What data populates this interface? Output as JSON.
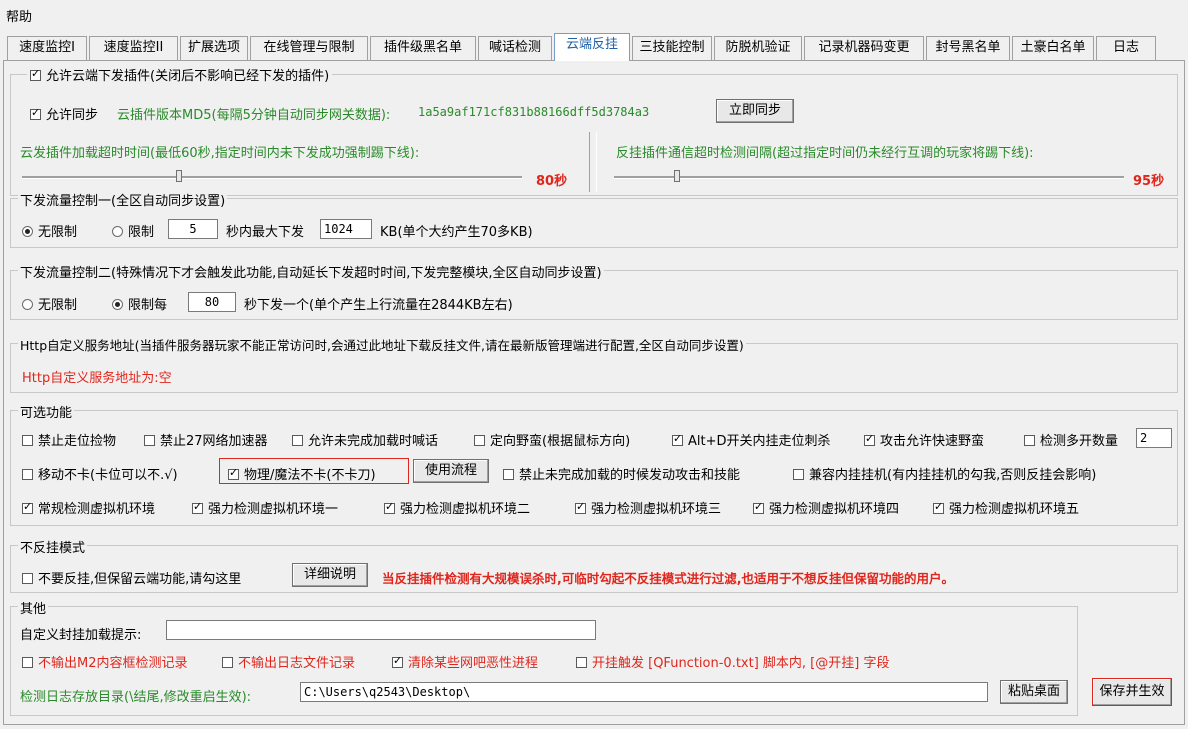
{
  "menu": {
    "help": "帮助"
  },
  "tabs": [
    "速度监控I",
    "速度监控II",
    "扩展选项",
    "在线管理与限制",
    "插件级黑名单",
    "喊话检测",
    "云端反挂",
    "三技能控制",
    "防脱机验证",
    "记录机器码变更",
    "封号黑名单",
    "土豪白名单",
    "日志"
  ],
  "active_tab": "云端反挂",
  "cloud": {
    "allow_cloud_label": "允许云端下发插件(关闭后不影响已经下发的插件)",
    "allow_sync_label": "允许同步",
    "md5_label": "云插件版本MD5(每隔5分钟自动同步网关数据):",
    "md5_value": "1a5a9af171cf831b88166dff5d3784a3",
    "sync_now": "立即同步",
    "timeout_label": "云发插件加载超时时间(最低60秒,指定时间内未下发成功强制踢下线):",
    "timeout_value": "80秒",
    "comm_label": "反挂插件通信超时检测间隔(超过指定时间仍未经行互调的玩家将踢下线):",
    "comm_value": "95秒"
  },
  "flow1": {
    "title": "下发流量控制一(全区自动同步设置)",
    "unlimited": "无限制",
    "limit": "限制",
    "seconds": "5",
    "mid_label": "秒内最大下发",
    "kb": "1024",
    "kb_label": "KB(单个大约产生70多KB)"
  },
  "flow2": {
    "title": "下发流量控制二(特殊情况下才会触发此功能,自动延长下发超时时间,下发完整模块,全区自动同步设置)",
    "unlimited": "无限制",
    "limit_each": "限制每",
    "seconds": "80",
    "tail": "秒下发一个(单个产生上行流量在2844KB左右)"
  },
  "http": {
    "title": "Http自定义服务地址(当插件服务器玩家不能正常访问时,会通过此地址下载反挂文件,请在最新版管理端进行配置,全区自动同步设置)",
    "value": "Http自定义服务地址为:空"
  },
  "optional": {
    "title": "可选功能",
    "row1": [
      "禁止走位捡物",
      "禁止27网络加速器",
      "允许未完成加载时喊话",
      "定向野蛮(根据鼠标方向)",
      "Alt+D开关内挂走位刺杀",
      "攻击允许快速野蛮",
      "检测多开数量"
    ],
    "multi_count": "2",
    "row2": [
      "移动不卡(卡位可以不.√)",
      "物理/魔法不卡(不卡刀)",
      "禁止未完成加载的时候发动攻击和技能",
      "兼容内挂挂机(有内挂挂机的勾我,否则反挂会影响)"
    ],
    "usage_button": "使用流程",
    "row3": [
      "常规检测虚拟机环境",
      "强力检测虚拟机环境一",
      "强力检测虚拟机环境二",
      "强力检测虚拟机环境三",
      "强力检测虚拟机环境四",
      "强力检测虚拟机环境五"
    ]
  },
  "noanti": {
    "title": "不反挂模式",
    "label": "不要反挂,但保留云端功能,请勾这里",
    "details_button": "详细说明",
    "warning": "当反挂插件检测有大规模误杀时,可临时勾起不反挂模式进行过滤,也适用于不想反挂但保留功能的用户。"
  },
  "other": {
    "title": "其他",
    "custom_label": "自定义封挂加载提示:",
    "custom_value": "",
    "opts": [
      "不输出M2内容框检测记录",
      "不输出日志文件记录",
      "清除某些网吧恶性进程",
      "开挂触发 [QFunction-0.txt] 脚本内, [@开挂] 字段"
    ],
    "log_dir_label": "检测日志存放目录(\\结尾,修改重启生效):",
    "log_dir_value": "C:\\Users\\q2543\\Desktop\\",
    "paste_button": "粘贴桌面",
    "save_button": "保存并生效"
  },
  "colors": {
    "green": "#2a8a2a",
    "red": "#e0261c",
    "active_tab": "#1f5fa8"
  }
}
